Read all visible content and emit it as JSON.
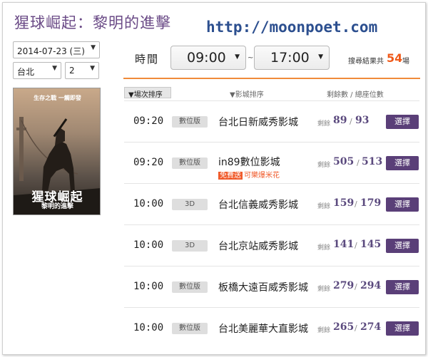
{
  "page": {
    "title": "猩球崛起：黎明的進擊",
    "site_url": "http://moonpoet.com"
  },
  "filters": {
    "date": "2014-07-23 (三)",
    "city": "台北",
    "count": "2"
  },
  "poster": {
    "tagline": "生存之戰 一觸即發",
    "title_line1": "猩球崛起",
    "title_line2": "黎明的進擊"
  },
  "time_filter": {
    "label": "時間",
    "from": "09:00",
    "tilde": "~",
    "to": "17:00",
    "result_label": "搜尋結果共",
    "result_count": "54",
    "result_unit": "場"
  },
  "table_headers": {
    "sort_showtime": "▼場次排序",
    "sort_cinema": "▼影城排序",
    "seats": "剩餘數 / 總座位數"
  },
  "showtimes": [
    {
      "time": "09:20",
      "format": "數位版",
      "cinema": "台北日新威秀影城",
      "remain_label": "剩餘",
      "remain": "89",
      "slash": "/",
      "total": "93",
      "button": "選擇"
    },
    {
      "time": "09:20",
      "format": "數位版",
      "cinema": "in89數位影城",
      "promo_tag": "免費送",
      "promo_text": "可樂爆米花",
      "remain_label": "剩餘",
      "remain": "505",
      "slash": "/",
      "total": "513",
      "button": "選擇"
    },
    {
      "time": "10:00",
      "format": "3D",
      "cinema": "台北信義威秀影城",
      "remain_label": "剩餘",
      "remain": "159",
      "slash": "/",
      "total": "179",
      "button": "選擇"
    },
    {
      "time": "10:00",
      "format": "3D",
      "cinema": "台北京站威秀影城",
      "remain_label": "剩餘",
      "remain": "141",
      "slash": "/",
      "total": "145",
      "button": "選擇"
    },
    {
      "time": "10:00",
      "format": "數位版",
      "cinema": "板橋大遠百威秀影城",
      "remain_label": "剩餘",
      "remain": "279",
      "slash": "/",
      "total": "294",
      "button": "選擇"
    },
    {
      "time": "10:00",
      "format": "數位版",
      "cinema": "台北美麗華大直影城",
      "remain_label": "剩餘",
      "remain": "265",
      "slash": "/",
      "total": "274",
      "button": "選擇"
    }
  ],
  "colors": {
    "title": "#6a4a86",
    "accent_orange": "#f05a1a",
    "choose_button": "#5a3f78",
    "seat_numbers": "#5b4a7e"
  }
}
